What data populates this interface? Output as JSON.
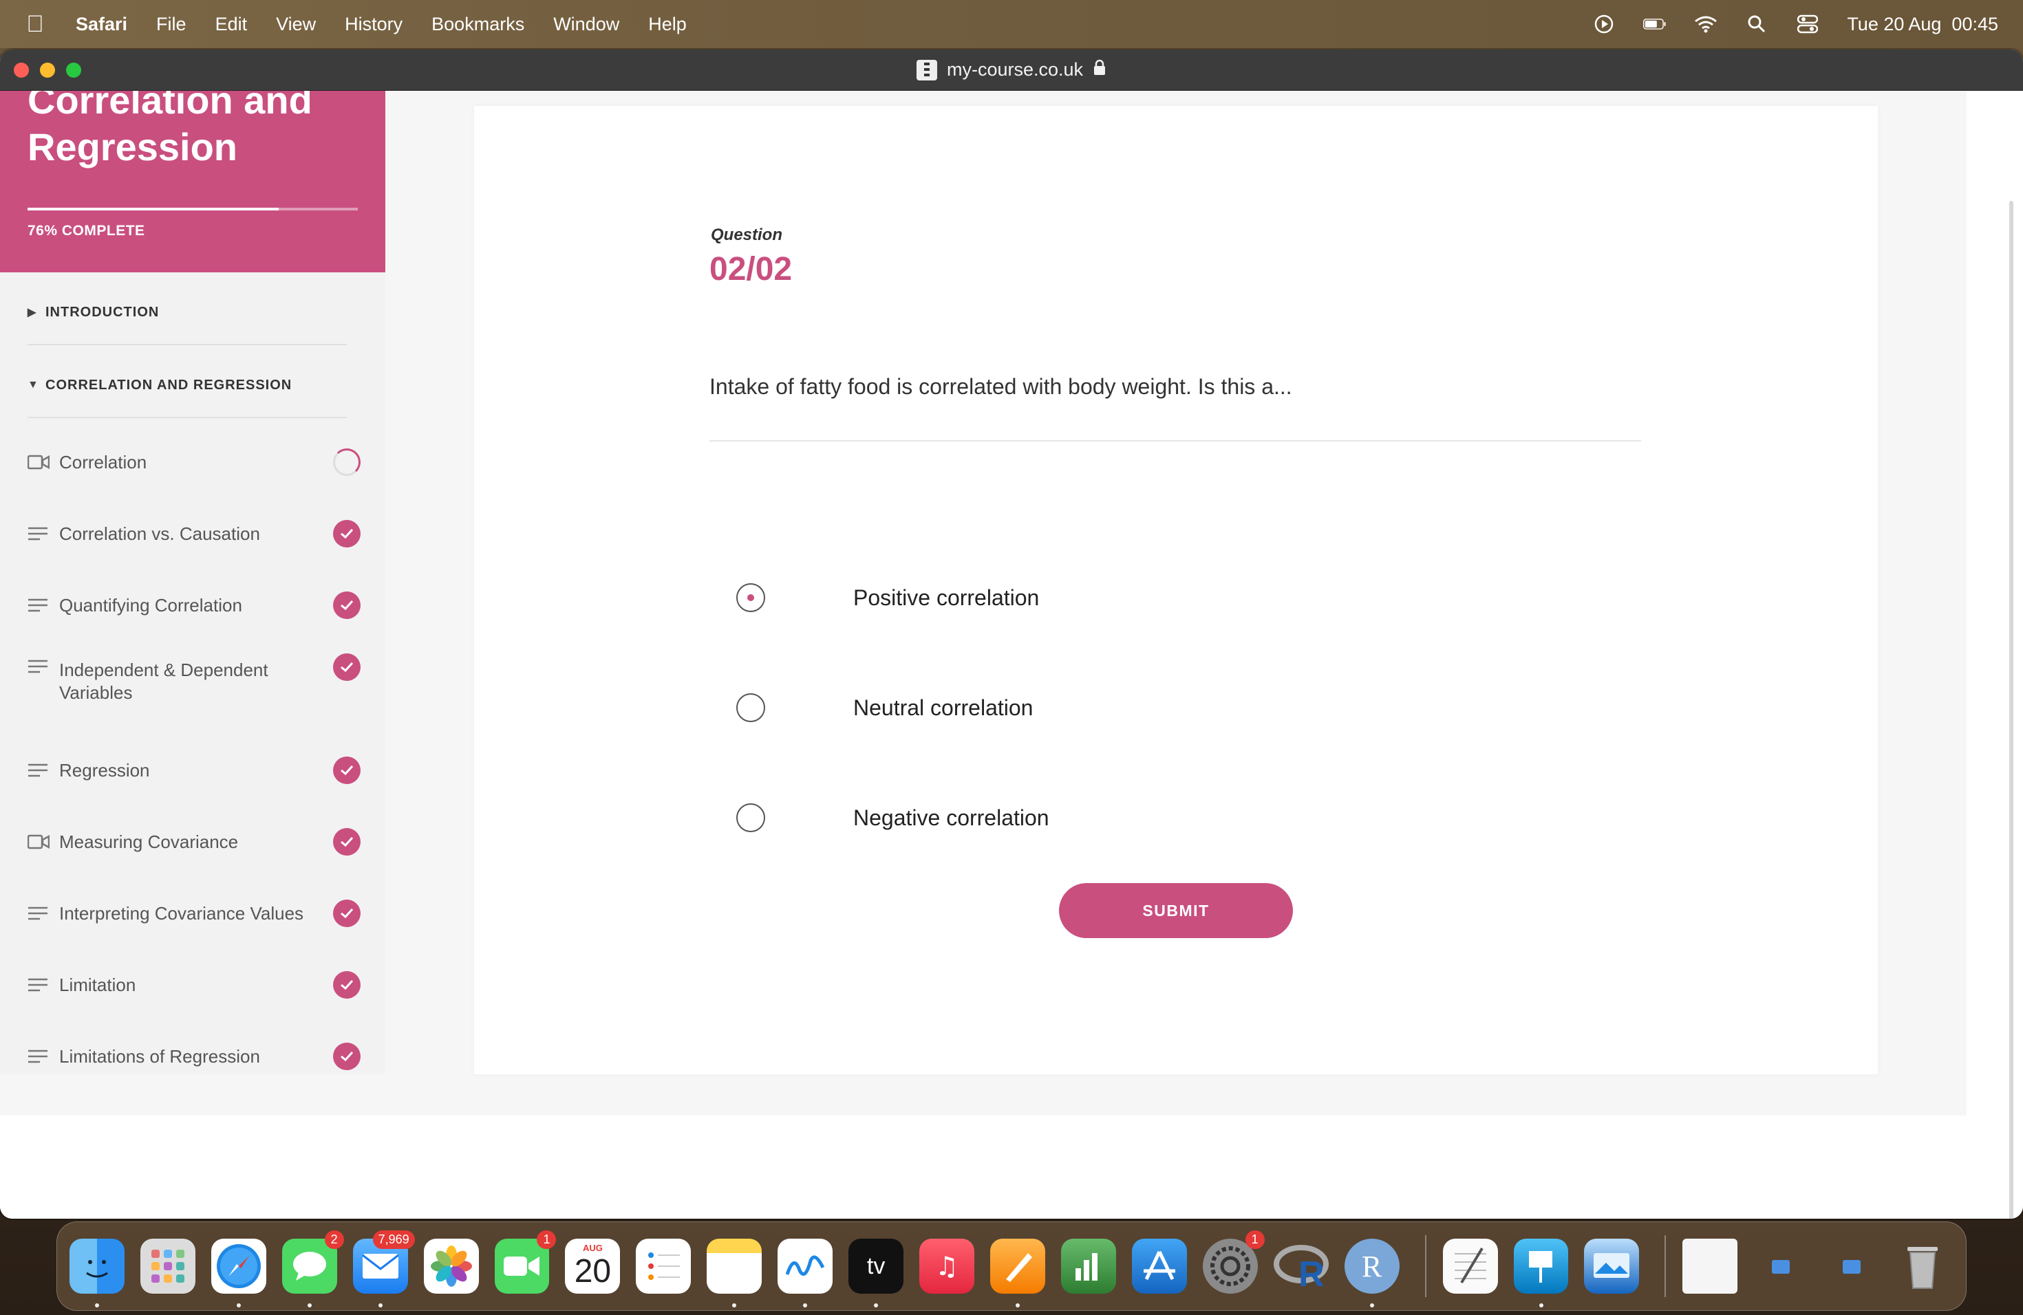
{
  "menubar": {
    "app": "Safari",
    "items": [
      "File",
      "Edit",
      "View",
      "History",
      "Bookmarks",
      "Window",
      "Help"
    ],
    "clock": "Tue 20 Aug  00:45"
  },
  "browser": {
    "url": "my-course.co.uk"
  },
  "sidebar": {
    "course_title_line1": "Correlation and",
    "course_title_line2": "Regression",
    "progress_percent": 76,
    "progress_text": "76% COMPLETE",
    "sections": [
      {
        "label": "INTRODUCTION",
        "expanded": false
      },
      {
        "label": "CORRELATION AND REGRESSION",
        "expanded": true
      }
    ],
    "lessons": [
      {
        "label": "Correlation",
        "icon": "video-icon",
        "status": "in-progress"
      },
      {
        "label": "Correlation vs. Causation",
        "icon": "text-lines-icon",
        "status": "complete"
      },
      {
        "label": "Quantifying Correlation",
        "icon": "text-lines-icon",
        "status": "complete"
      },
      {
        "label": "Independent & Dependent Variables",
        "icon": "text-lines-icon",
        "status": "complete"
      },
      {
        "label": "Regression",
        "icon": "text-lines-icon",
        "status": "complete"
      },
      {
        "label": "Measuring Covariance",
        "icon": "video-icon",
        "status": "complete"
      },
      {
        "label": "Interpreting Covariance Values",
        "icon": "text-lines-icon",
        "status": "complete"
      },
      {
        "label": "Limitation",
        "icon": "text-lines-icon",
        "status": "complete"
      },
      {
        "label": "Limitations of Regression",
        "icon": "text-lines-icon",
        "status": "complete"
      }
    ]
  },
  "quiz": {
    "label": "Question",
    "number": "02/02",
    "question": "Intake of fatty food is correlated with body weight. Is this a...",
    "options": [
      {
        "label": "Positive correlation",
        "selected": true
      },
      {
        "label": "Neutral correlation",
        "selected": false
      },
      {
        "label": "Negative correlation",
        "selected": false
      }
    ],
    "submit_label": "SUBMIT"
  },
  "dock": {
    "badges": {
      "messages": "2",
      "mail": "7,969",
      "facetime": "1",
      "settings": "1"
    },
    "calendar_month": "AUG",
    "calendar_day": "20",
    "tv_label": "tv"
  },
  "colors": {
    "accent": "#c94f7f",
    "sidebar_bg": "#f2f2f2",
    "titlebar": "#3c3c3c"
  }
}
